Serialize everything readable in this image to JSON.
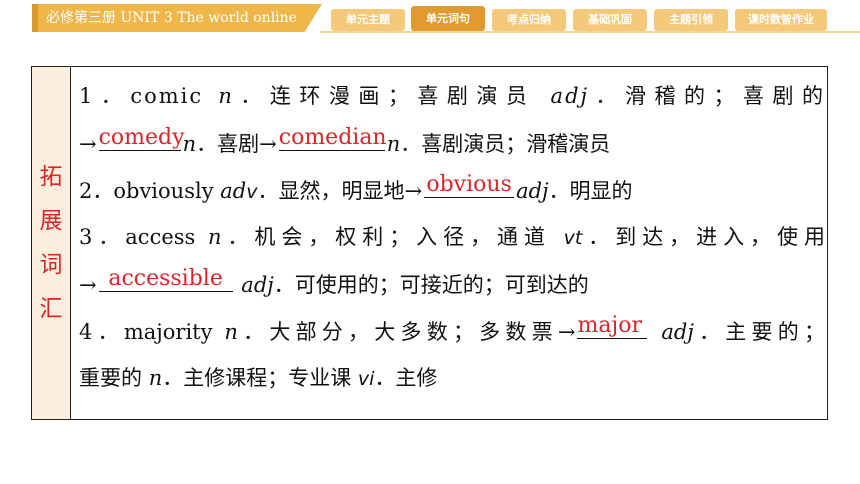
{
  "header": {
    "book": "必修第三册  UNIT 3  The world online",
    "tabs": [
      {
        "label": "单元主题"
      },
      {
        "label": "单元词句"
      },
      {
        "label": "考点归纳"
      },
      {
        "label": "基础巩固"
      },
      {
        "label": "主题引领"
      },
      {
        "label": "课时数智作业"
      }
    ]
  },
  "section": {
    "side_label": [
      "拓",
      "展",
      "词",
      "汇"
    ]
  },
  "entries": {
    "e1_a": "1．comic",
    "e1_b": "n",
    "e1_c": "．连环漫画；喜剧演员",
    "e1_d": "adj",
    "e1_e": "．滑稽的；喜剧的",
    "e1_arrow": "→",
    "e1_ans1": "comedy",
    "e1_f": "n",
    "e1_g": "．喜剧→",
    "e1_ans2": "comedian",
    "e1_h": "n",
    "e1_i": "．喜剧演员；滑稽演员",
    "e2_a": "2．obviously",
    "e2_b": "ad",
    "e2_c": "v",
    "e2_d": "．显然，明显地→",
    "e2_ans": "obvious",
    "e2_e": "adj",
    "e2_f": "．明显的",
    "e3_a": "3．access",
    "e3_b": "n",
    "e3_c": "．机会，权利；入径，通道",
    "e3_d": "vt",
    "e3_e": "．到达，进入，使用",
    "e3_arrow": "→",
    "e3_ans": "accessible",
    "e3_f": "adj",
    "e3_g": "．可使用的；可接近的；可到达的",
    "e4_a": "4．majority",
    "e4_b": "n",
    "e4_c": "．大部分，大多数；多数票→",
    "e4_ans": "major",
    "e4_d": "adj",
    "e4_e": "．主要的；",
    "e4_f": "重要的",
    "e4_g": "n",
    "e4_h": "．主修课程；专业课",
    "e4_i": "vi",
    "e4_j": "．主修"
  },
  "colors": {
    "accent": "#efb74a",
    "active_tab": "#e09a2e",
    "tab": "#f4c97a",
    "answer": "#d9262a",
    "side_bg": "#fbeedd"
  }
}
